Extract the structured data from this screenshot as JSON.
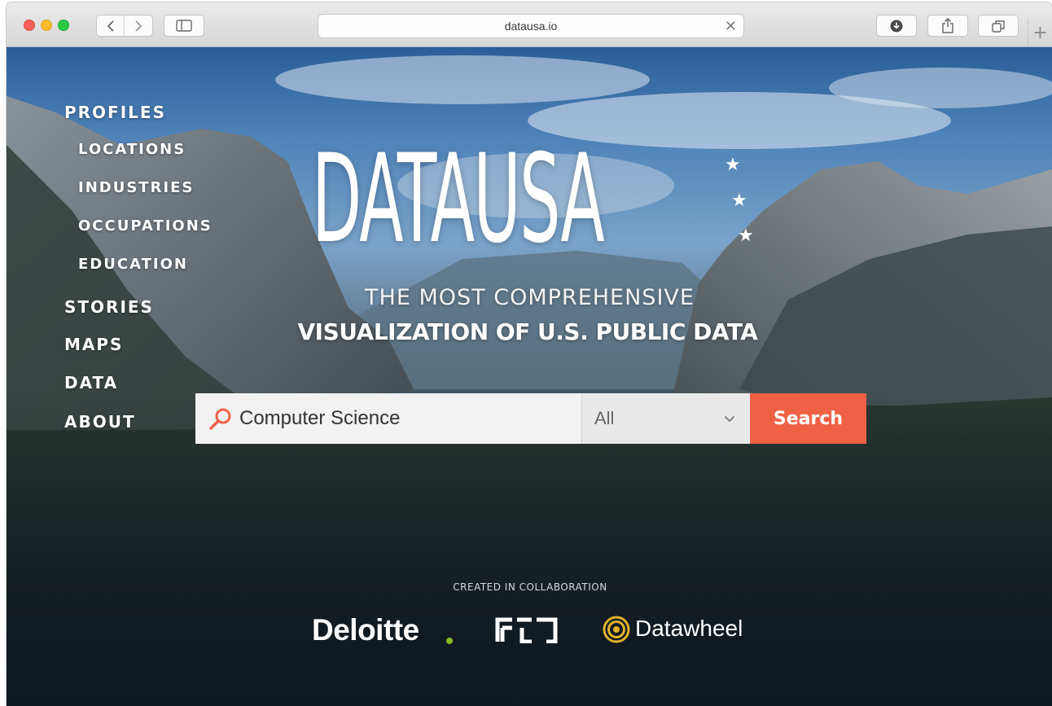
{
  "browser": {
    "url": "datausa.io",
    "icons": {
      "back": "chevron-left-icon",
      "forward": "chevron-right-icon",
      "sidebar": "sidebar-icon",
      "clear": "close-icon",
      "download": "download-icon",
      "share": "share-icon",
      "tabs": "tabs-icon",
      "new_tab": "plus-icon"
    },
    "new_tab_label": "+"
  },
  "nav": {
    "profiles": "PROFILES",
    "locations": "LOCATIONS",
    "industries": "INDUSTRIES",
    "occupations": "OCCUPATIONS",
    "education": "EDUCATION",
    "stories": "STORIES",
    "maps": "MAPS",
    "data": "DATA",
    "about": "ABOUT"
  },
  "hero": {
    "logo": "DATAUSA",
    "tagline_line1": "THE MOST COMPREHENSIVE",
    "tagline_line2": "VISUALIZATION OF U.S. PUBLIC DATA"
  },
  "search": {
    "value": "Computer Science",
    "select_value": "All",
    "button_label": "Search",
    "icon": "search-icon"
  },
  "footer": {
    "collab_label": "CREATED IN COLLABORATION",
    "partner1": "Deloitte",
    "partner3": "Datawheel"
  },
  "colors": {
    "accent": "#ef6145",
    "deloitte_dot": "#86bc25",
    "datawheel_gold": "#e2b22c"
  }
}
